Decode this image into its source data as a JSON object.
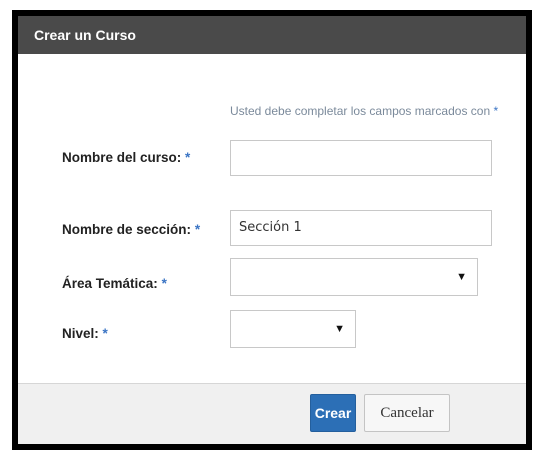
{
  "dialog": {
    "title": "Crear un Curso",
    "required_note": "Usted debe completar los campos marcados con",
    "required_marker": "*"
  },
  "form": {
    "course_name": {
      "label": "Nombre del curso:",
      "marker": "*",
      "value": ""
    },
    "section_name": {
      "label": "Nombre de sección:",
      "marker": "*",
      "value": "Sección 1"
    },
    "subject_area": {
      "label": "Área Temática:",
      "marker": "*",
      "selected": ""
    },
    "level": {
      "label": "Nivel:",
      "marker": "*",
      "selected": ""
    }
  },
  "buttons": {
    "create": "Crear",
    "cancel": "Cancelar"
  },
  "icons": {
    "dropdown_arrow": "▼"
  },
  "colors": {
    "title_bar": "#4a4a4a",
    "required_marker": "#3a74c4",
    "primary_button": "#2c6fb6"
  }
}
